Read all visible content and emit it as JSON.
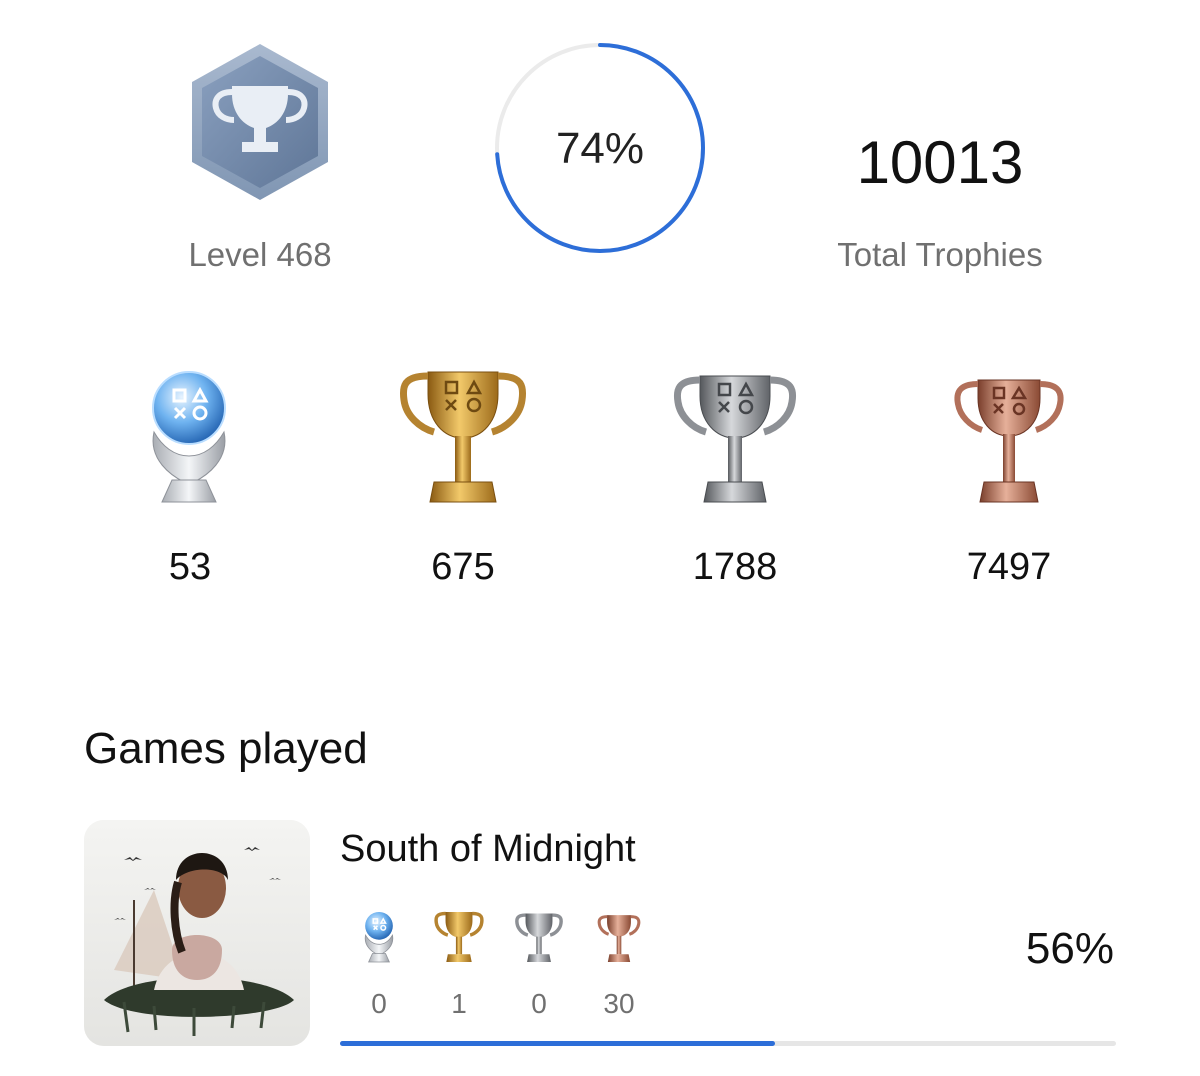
{
  "summary": {
    "level_label": "Level 468",
    "level_icon": "level-trophy-badge-icon",
    "progress_text": "74%",
    "progress_value": 0.74,
    "total_number": "10013",
    "total_label": "Total Trophies",
    "accent_color": "#2d6ed8"
  },
  "trophies": {
    "platinum": {
      "count": "53",
      "icon": "platinum-trophy-icon"
    },
    "gold": {
      "count": "675",
      "icon": "gold-trophy-icon"
    },
    "silver": {
      "count": "1788",
      "icon": "silver-trophy-icon"
    },
    "bronze": {
      "count": "7497",
      "icon": "bronze-trophy-icon"
    }
  },
  "games": {
    "heading": "Games played",
    "items": [
      {
        "title": "South of Midnight",
        "cover_icon": "game-cover-art",
        "trophies": {
          "platinum": "0",
          "gold": "1",
          "silver": "0",
          "bronze": "30"
        },
        "percent_text": "56%",
        "progress_value": 0.56
      }
    ]
  }
}
